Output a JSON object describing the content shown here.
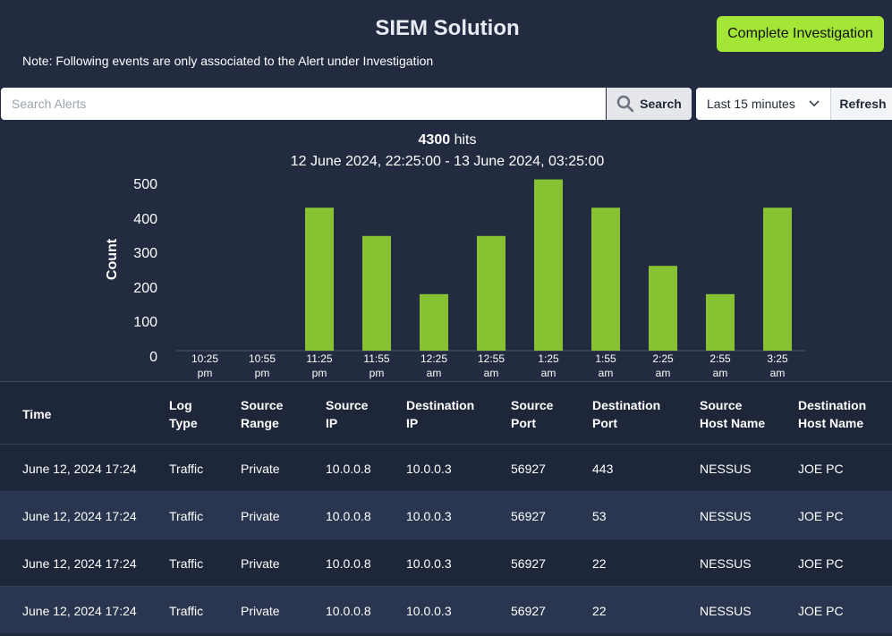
{
  "app": {
    "title": "SIEM Solution",
    "note": "Note: Following events are only associated to the Alert under Investigation",
    "complete_label": "Complete Investigation",
    "accent_color": "#a3e635"
  },
  "search": {
    "placeholder": "Search Alerts",
    "button_label": "Search",
    "icon": "search-icon"
  },
  "filter": {
    "range_value": "Last 15 minutes",
    "refresh_label": "Refresh"
  },
  "hits": {
    "count": "4300",
    "suffix": " hits",
    "range": "12 June 2024, 22:25:00 - 13 June 2024, 03:25:00"
  },
  "chart_data": {
    "type": "bar",
    "ylabel": "Count",
    "categories": [
      "10:25 pm",
      "10:55 pm",
      "11:25 pm",
      "11:55 pm",
      "12:25 am",
      "12:55 am",
      "1:25 am",
      "1:55 am",
      "2:25 am",
      "2:55 am",
      "3:25 am"
    ],
    "category_lines": [
      [
        "10:25",
        "pm"
      ],
      [
        "10:55",
        "pm"
      ],
      [
        "11:25",
        "pm"
      ],
      [
        "11:55",
        "pm"
      ],
      [
        "12:25",
        "am"
      ],
      [
        "12:55",
        "am"
      ],
      [
        "1:25",
        "am"
      ],
      [
        "1:55",
        "am"
      ],
      [
        "2:25",
        "am"
      ],
      [
        "2:55",
        "am"
      ],
      [
        "3:25",
        "am"
      ]
    ],
    "values": [
      0,
      0,
      430,
      345,
      170,
      345,
      515,
      430,
      255,
      170,
      430
    ],
    "yticks": [
      0,
      100,
      200,
      300,
      400,
      500
    ],
    "ylim": [
      0,
      530
    ],
    "bar_color": "#86c232"
  },
  "table": {
    "headers": [
      [
        "Time"
      ],
      [
        "Log",
        "Type"
      ],
      [
        "Source",
        "Range"
      ],
      [
        "Source",
        "IP"
      ],
      [
        "Destination",
        "IP"
      ],
      [
        "Source",
        "Port"
      ],
      [
        "Destination",
        "Port"
      ],
      [
        "Source",
        "Host Name"
      ],
      [
        "Destination",
        "Host Name"
      ]
    ],
    "rows": [
      [
        "June 12, 2024 17:24",
        "Traffic",
        "Private",
        "10.0.0.8",
        "10.0.0.3",
        "56927",
        "443",
        "NESSUS",
        "JOE PC"
      ],
      [
        "June 12, 2024 17:24",
        "Traffic",
        "Private",
        "10.0.0.8",
        "10.0.0.3",
        "56927",
        "53",
        "NESSUS",
        "JOE PC"
      ],
      [
        "June 12, 2024 17:24",
        "Traffic",
        "Private",
        "10.0.0.8",
        "10.0.0.3",
        "56927",
        "22",
        "NESSUS",
        "JOE PC"
      ],
      [
        "June 12, 2024 17:24",
        "Traffic",
        "Private",
        "10.0.0.8",
        "10.0.0.3",
        "56927",
        "22",
        "NESSUS",
        "JOE PC"
      ]
    ]
  }
}
